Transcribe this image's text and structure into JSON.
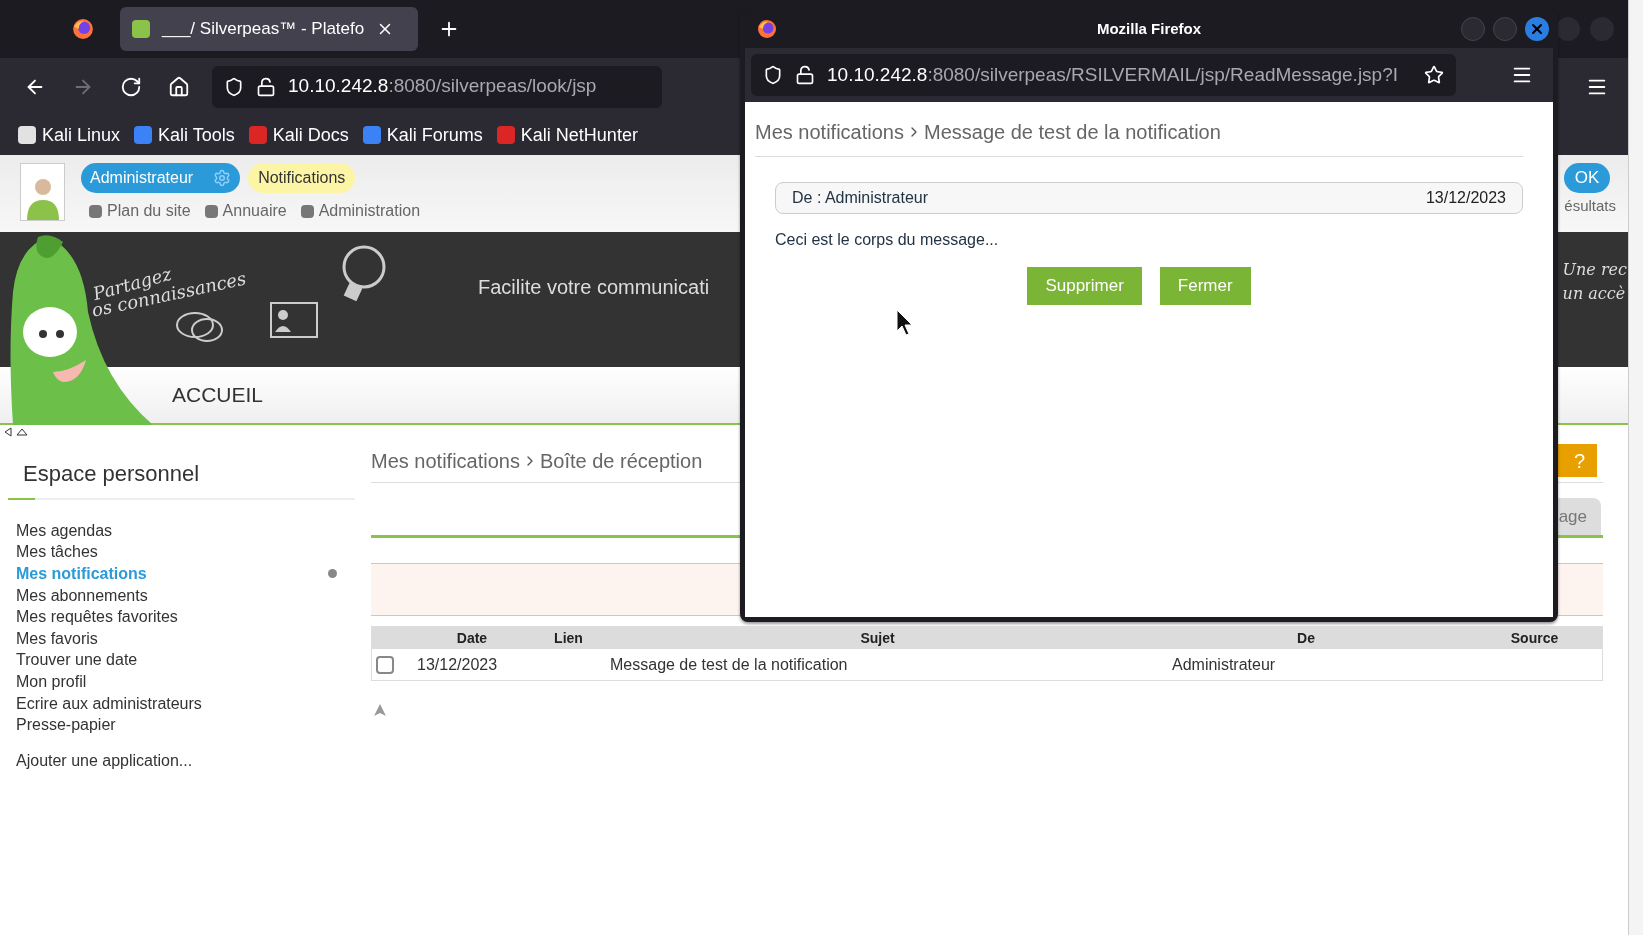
{
  "browser": {
    "tab_title": "___/ Silverpeas™ - Platefo",
    "url_host": "10.10.242.8",
    "url_path": ":8080/silverpeas/look/jsp",
    "bookmarks": [
      {
        "label": "Kali Linux",
        "color": "#e2e2e2"
      },
      {
        "label": "Kali Tools",
        "color": "#3b82f6"
      },
      {
        "label": "Kali Docs",
        "color": "#dc2626"
      },
      {
        "label": "Kali Forums",
        "color": "#3b82f6"
      },
      {
        "label": "Kali NetHunter",
        "color": "#dc2626"
      }
    ]
  },
  "header": {
    "user": "Administrateur",
    "notifications": "Notifications",
    "links": [
      "Plan du site",
      "Annuaire",
      "Administration"
    ],
    "search_button": "OK",
    "search_label": "ésultats"
  },
  "banner": {
    "tagline_1": "Partagez",
    "tagline_2": "os connaissances",
    "slogan": "Facilite votre communicati",
    "right_1": "Une rec",
    "right_2": "un accè"
  },
  "menu": {
    "items": [
      {
        "label": "ACCUEIL"
      }
    ]
  },
  "sidebar": {
    "title": "Espace personnel",
    "items": [
      {
        "label": "Mes agendas",
        "selected": false
      },
      {
        "label": "Mes tâches",
        "selected": false
      },
      {
        "label": "Mes notifications",
        "selected": true
      },
      {
        "label": "Mes abonnements",
        "selected": false
      },
      {
        "label": "Mes requêtes favorites",
        "selected": false
      },
      {
        "label": "Mes favoris",
        "selected": false
      },
      {
        "label": "Trouver une date",
        "selected": false
      },
      {
        "label": "Mon profil",
        "selected": false
      },
      {
        "label": "Ecrire aux administrateurs",
        "selected": false
      },
      {
        "label": "Presse-papier",
        "selected": false
      }
    ],
    "add_link": "Ajouter une application..."
  },
  "main": {
    "breadcrumb": [
      "Mes notifications",
      "Boîte de réception"
    ],
    "help_button": "?",
    "tab": "age",
    "table": {
      "columns": [
        "Date",
        "Lien",
        "Sujet",
        "De",
        "Source"
      ],
      "rows": [
        {
          "checked": false,
          "date": "13/12/2023",
          "subject": "Message de test de la notification",
          "from": "Administrateur"
        }
      ]
    }
  },
  "popup": {
    "title": "Mozilla Firefox",
    "url_host": "10.10.242.8",
    "url_path": ":8080/silverpeas/RSILVERMAIL/jsp/ReadMessage.jsp?I",
    "breadcrumb": [
      "Mes notifications",
      "Message de test de la notification"
    ],
    "from": "De : Administrateur",
    "date": "13/12/2023",
    "body": "Ceci est le corps du message...",
    "buttons": [
      "Supprimer",
      "Fermer"
    ]
  }
}
